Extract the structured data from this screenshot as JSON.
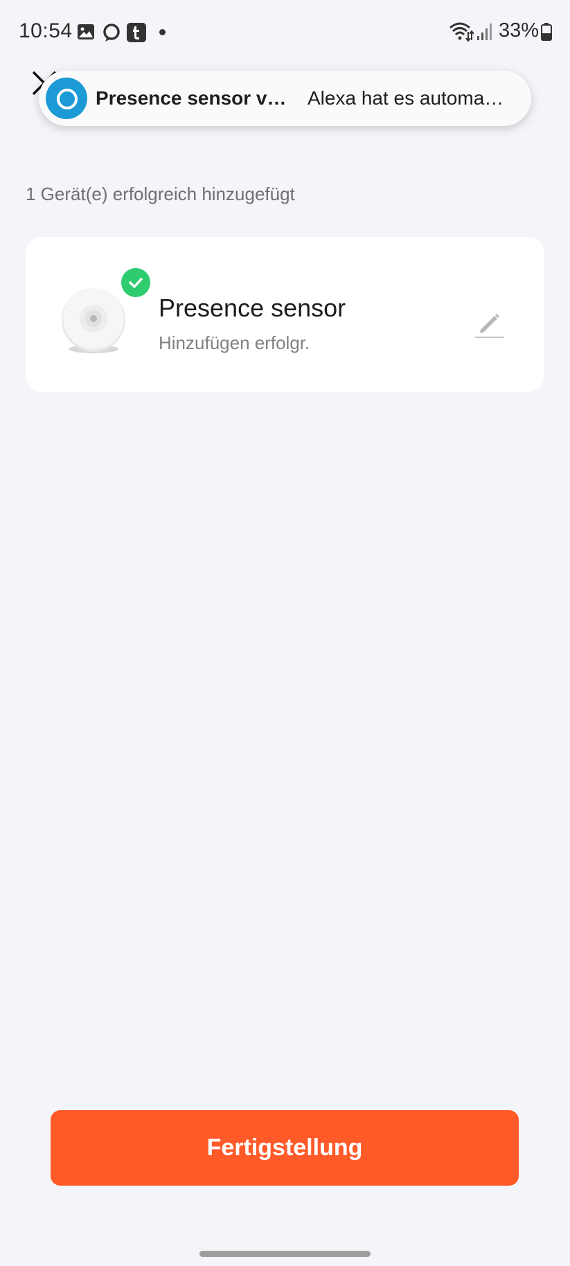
{
  "status_bar": {
    "time": "10:54",
    "battery": "33%",
    "icons": [
      "gallery-icon",
      "alexa-ring-icon",
      "tumblr-icon",
      "notification-dot",
      "wifi-icon",
      "signal-icon",
      "battery-icon"
    ]
  },
  "toast": {
    "title": "Presence sensor ve…",
    "message": "Alexa hat es automa…",
    "icon": "alexa-icon"
  },
  "summary_text": "1 Gerät(e) erfolgreich hinzugefügt",
  "device": {
    "name": "Presence sensor",
    "status": "Hinzufügen erfolgr.",
    "status_color": "#2fcb6f"
  },
  "finish_button": {
    "label": "Fertigstellung",
    "color": "#ff5a28"
  }
}
